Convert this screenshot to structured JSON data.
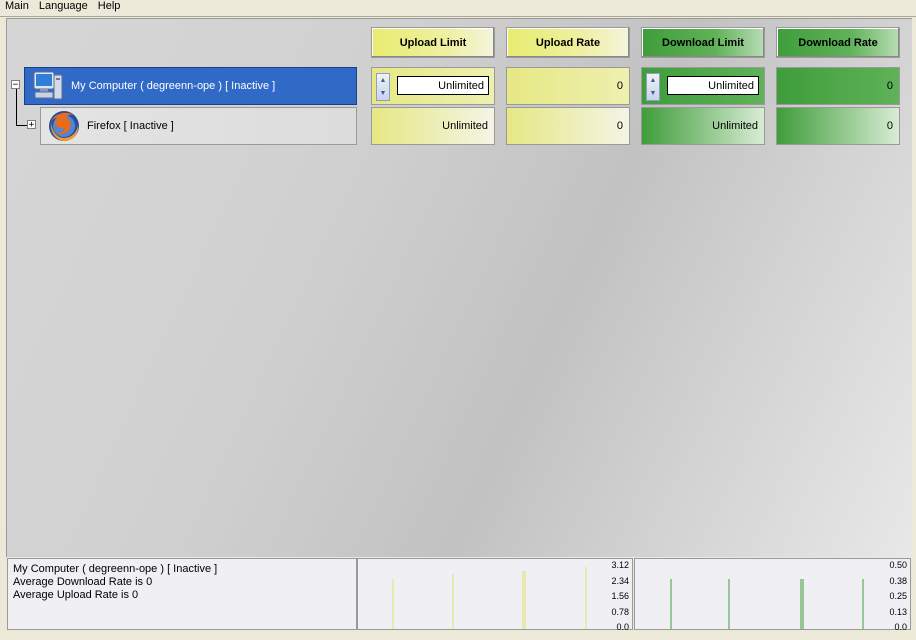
{
  "menu": [
    "Main",
    "Language",
    "Help"
  ],
  "columns": {
    "upload_limit": "Upload Limit",
    "upload_rate": "Upload Rate",
    "download_limit": "Download Limit",
    "download_rate": "Download Rate"
  },
  "tree": {
    "computer": {
      "label": "My Computer ( degreenn-ope ) [ Inactive ]",
      "upload_limit": "Unlimited",
      "upload_rate": "0",
      "download_limit": "Unlimited",
      "download_rate": "0",
      "icon": "computer-icon"
    },
    "firefox": {
      "label": "Firefox  [ Inactive ]",
      "upload_limit": "Unlimited",
      "upload_rate": "0",
      "download_limit": "Unlimited",
      "download_rate": "0",
      "icon": "firefox-icon"
    }
  },
  "status": {
    "line1": "My Computer ( degreenn-ope ) [ Inactive ]",
    "line2": "Average Download Rate is 0",
    "line3": "Average Upload Rate is 0"
  },
  "upload_graph": {
    "ticks": [
      "3.12",
      "2.34",
      "1.56",
      "0.78",
      "0.0"
    ],
    "color": "#e0e070"
  },
  "download_graph": {
    "ticks": [
      "0.50",
      "0.38",
      "0.25",
      "0.13",
      "0.0"
    ],
    "color": "#3f9d3a"
  },
  "colors": {
    "selection": "#3169c6",
    "yellow": "#e6e884",
    "green": "#3f9d3a"
  }
}
